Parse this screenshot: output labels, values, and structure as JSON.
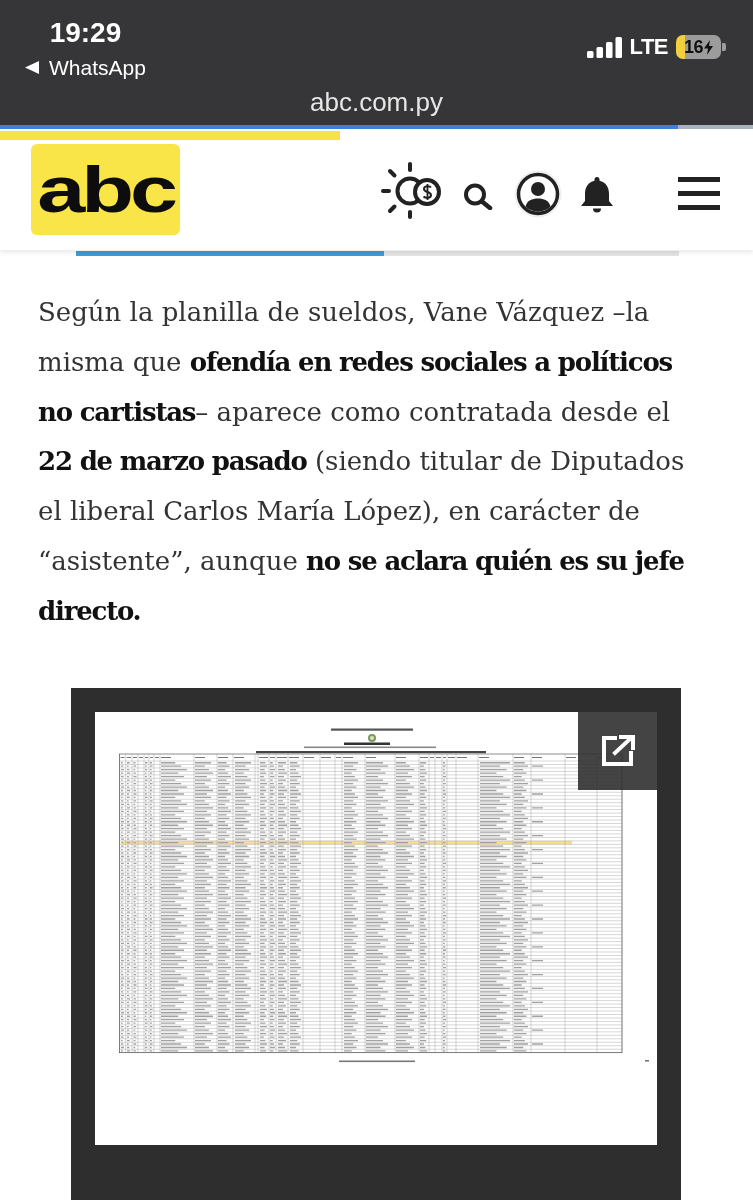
{
  "status_bar": {
    "time": "19:29",
    "back_app": "WhatsApp",
    "network": "LTE",
    "battery": "16",
    "charging": true,
    "low_power_mode": true
  },
  "browser": {
    "url": "abc.com.py",
    "load_progress": {
      "level": 0.9
    }
  },
  "site_header": {
    "logo": "abc",
    "read_progress": {
      "level": 0.51
    }
  },
  "article": {
    "paragraph": "Según la planilla de sueldos, Vane Vázquez –la misma que **ofendía en redes sociales a políticos no cartistas**– aparece como contratada desde el **22 de marzo pasado** (siendo titular de Diputados el liberal Carlos María López), en carácter de “asistente”, aunque **no se aclara quién es su jefe directo.**"
  }
}
